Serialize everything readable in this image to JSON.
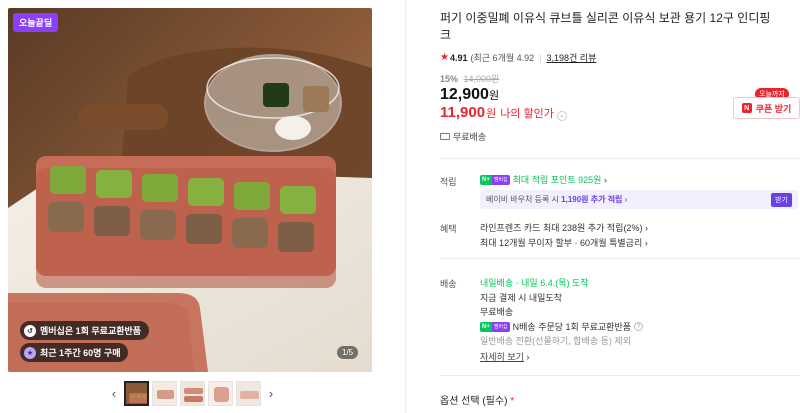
{
  "gallery": {
    "badge": "오늘끝딜",
    "pill_membership": "멤버십은 1회 무료교환반품",
    "pill_recent": "최근 1주간 60명 구매",
    "counter": "1/5",
    "prev": "‹",
    "next": "›",
    "thumb_count": 5
  },
  "product": {
    "title": "퍼기 이중밀폐 이유식 큐브틀 실리콘 이유식 보관 용기 12구 인디핑크",
    "rating": "4.91",
    "rating_note": "(최근 6개월 4.92",
    "review_count": "3,198건 리뷰",
    "discount_rate": "15%",
    "original_price": "14,000원",
    "price": "12,900",
    "price_unit": "원",
    "my_price": "11,900",
    "my_price_unit": "원",
    "my_price_label": "나의 할인가",
    "shipping": "무료배송"
  },
  "coupon": {
    "tag": "오늘까지",
    "label": "쿠폰 받기"
  },
  "points": {
    "section": "적립",
    "badge_n": "N+",
    "badge_member": "멤버십",
    "text": "최대 적립 포인트",
    "amount": "925원",
    "promo_prefix": "베이비 바우처 등록 시",
    "promo_amount": "1,190원 추가 적립",
    "promo_button": "받기"
  },
  "benefits": {
    "section": "혜택",
    "line1": "라인프렌즈 카드 최대 238원 추가 적립(2%) ›",
    "line2": "최대 12개월 무이자 할부 · 60개월 특별금리 ›"
  },
  "delivery": {
    "section": "배송",
    "tomorrow_label": "내일배송",
    "tomorrow_date": "· 내일 6.4.(목) 도착",
    "line2": "지금 결제 시 내일도착",
    "line3": "무료배송",
    "line4": "N배송 주문당 1회 무료교환반품",
    "line5": "일반배송 전환(선물하기, 합배송 등) 제외",
    "details": "자세히 보기"
  },
  "option": {
    "label": "옵션 선택 (필수)",
    "required_mark": "*"
  },
  "colors": {
    "accent_red": "#e8242e",
    "naver_green": "#03c75a",
    "membership_purple": "#8a3ffc"
  }
}
